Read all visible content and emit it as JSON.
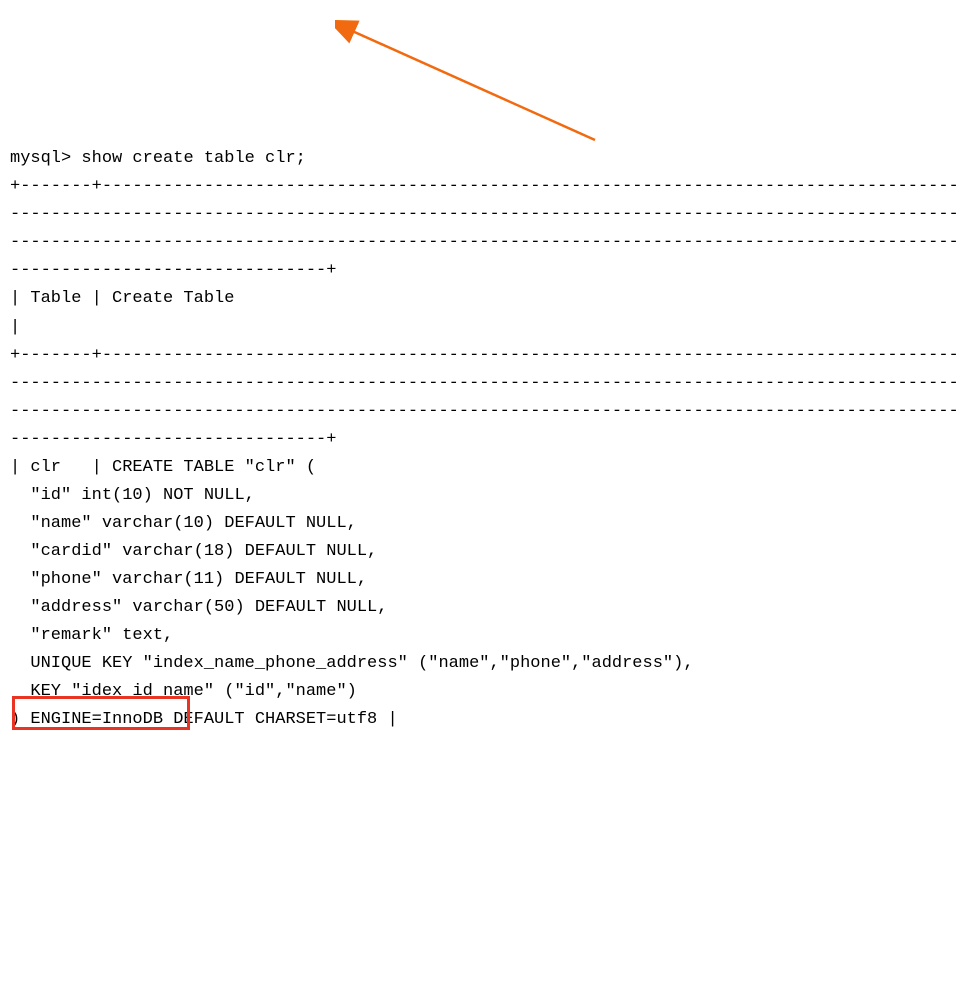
{
  "prompt": "mysql> ",
  "command": "show create table clr;",
  "border_top": "+-------+-------------------------------------------------------------------------------------------------------------------------------------------------------------------------------------------------------------------------------------------------------------------------------------------------------------+",
  "header": "| Table | Create Table                                                                                                                                                                                                                                                                                                    |",
  "border_mid": "+-------+-------------------------------------------------------------------------------------------------------------------------------------------------------------------------------------------------------------------------------------------------------------------------------------------------------------+",
  "row_start": "| clr   | CREATE TABLE \"clr\" (",
  "col_id": "  \"id\" int(10) NOT NULL,",
  "col_name": "  \"name\" varchar(10) DEFAULT NULL,",
  "col_cardid": "  \"cardid\" varchar(18) DEFAULT NULL,",
  "col_phone": "  \"phone\" varchar(11) DEFAULT NULL,",
  "col_address": "  \"address\" varchar(50) DEFAULT NULL,",
  "col_remark": "  \"remark\" text,",
  "key_unique": "  UNIQUE KEY \"index_name_phone_address\" (\"name\",\"phone\",\"address\"),",
  "key_idx": "  KEY \"idex_id_name\" (\"id\",\"name\")",
  "engine_line": ") ENGINE=InnoDB DEFAULT CHARSET=utf8 |",
  "annotations": {
    "arrow_color": "#f26a0f",
    "highlight_color": "#e93323",
    "highlighted_text": "ENGINE=InnoDB"
  }
}
